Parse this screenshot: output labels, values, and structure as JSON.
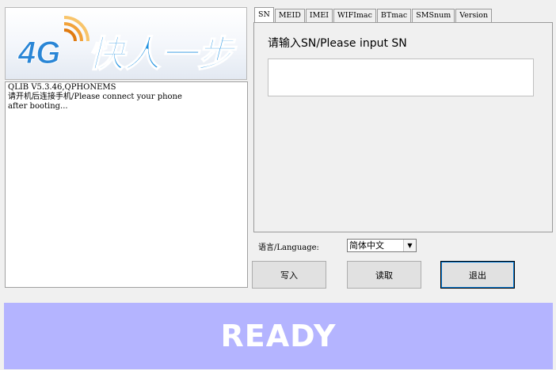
{
  "logo": {
    "text_4g": "4G",
    "slogan": "快人一步"
  },
  "log": {
    "lines": "QLIB V5.3.46,QPHONEMS\n请开机后连接手机/Please connect your phone\nafter booting..."
  },
  "tabs": [
    {
      "label": "SN"
    },
    {
      "label": "MEID"
    },
    {
      "label": "IMEI"
    },
    {
      "label": "WIFImac"
    },
    {
      "label": "BTmac"
    },
    {
      "label": "SMSnum"
    },
    {
      "label": "Version"
    }
  ],
  "sn_panel": {
    "prompt": "请输入SN/Please input SN",
    "input_value": ""
  },
  "language": {
    "label": "语言/Language:",
    "selected": "简体中文"
  },
  "buttons": {
    "write": "写入",
    "read": "读取",
    "exit": "退出"
  },
  "status": {
    "text": "READY",
    "color": "#b4b4ff"
  }
}
